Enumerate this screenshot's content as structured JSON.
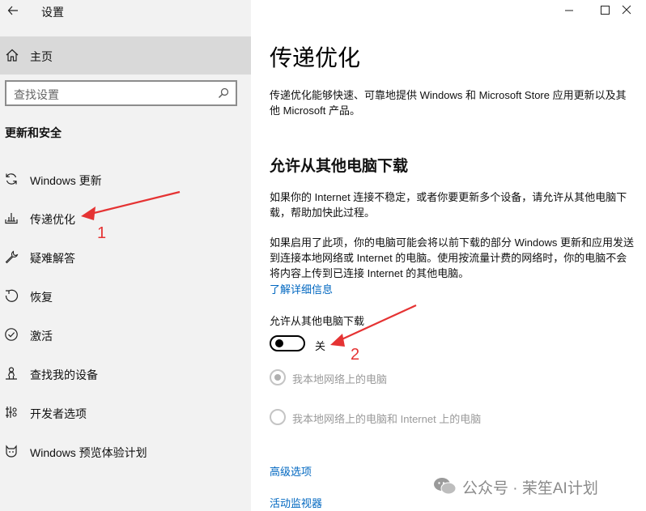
{
  "window": {
    "title": "设置"
  },
  "sidebar": {
    "home_label": "主页",
    "search_placeholder": "查找设置",
    "section_heading": "更新和安全",
    "items": [
      {
        "label": "Windows 更新",
        "icon": "sync-icon"
      },
      {
        "label": "传递优化",
        "icon": "delivery-optimization-icon"
      },
      {
        "label": "疑难解答",
        "icon": "wrench-icon"
      },
      {
        "label": "恢复",
        "icon": "recovery-icon"
      },
      {
        "label": "激活",
        "icon": "check-circle-icon"
      },
      {
        "label": "查找我的设备",
        "icon": "person-location-icon"
      },
      {
        "label": "开发者选项",
        "icon": "developer-icon"
      },
      {
        "label": "Windows 预览体验计划",
        "icon": "cat-icon"
      }
    ]
  },
  "main": {
    "title": "传递优化",
    "description": "传递优化能够快速、可靠地提供 Windows 和 Microsoft Store 应用更新以及其他 Microsoft 产品。",
    "section_heading": "允许从其他电脑下载",
    "para1": "如果你的 Internet 连接不稳定，或者你要更新多个设备，请允许从其他电脑下载，帮助加快此过程。",
    "para2": "如果启用了此项，你的电脑可能会将以前下载的部分 Windows 更新和应用发送到连接本地网络或 Internet 的电脑。使用按流量计费的网络时，你的电脑不会将内容上传到已连接 Internet 的其他电脑。",
    "learn_more": "了解详细信息",
    "toggle_label": "允许从其他电脑下载",
    "toggle_state": "关",
    "toggle_on": false,
    "radio_options": [
      {
        "label": "我本地网络上的电脑",
        "selected": true
      },
      {
        "label": "我本地网络上的电脑和 Internet 上的电脑",
        "selected": false
      }
    ],
    "advanced_link": "高级选项",
    "monitor_link": "活动监视器"
  },
  "annotations": {
    "num1": "1",
    "num2": "2",
    "color": "#e53333"
  },
  "watermark": {
    "text": "公众号 · 茉笙AI计划"
  }
}
